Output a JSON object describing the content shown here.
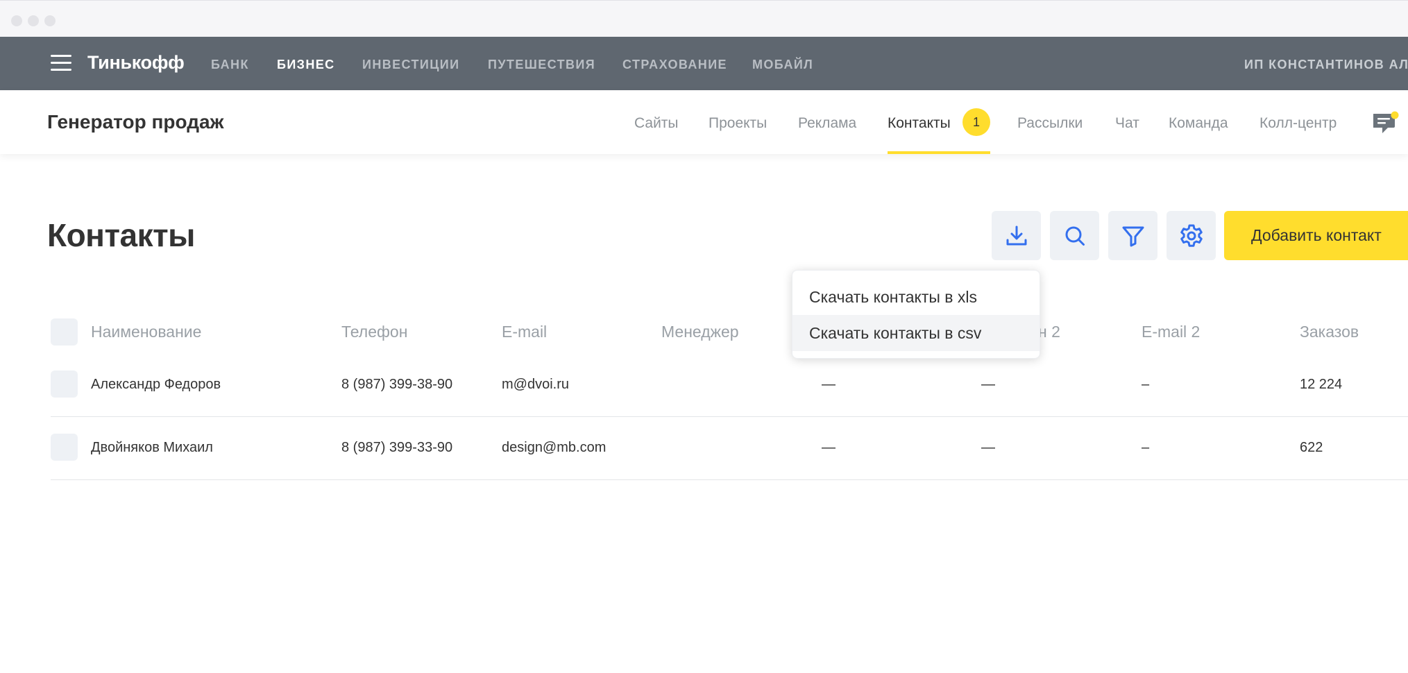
{
  "topnav": {
    "logo": "Тинькофф",
    "items": [
      "БАНК",
      "БИЗНЕС",
      "ИНВЕСТИЦИИ",
      "ПУТЕШЕСТВИЯ",
      "СТРАХОВАНИЕ",
      "МОБАЙЛ"
    ],
    "active": "БИЗНЕС",
    "user": "ИП КОНСТАНТИНОВ АЛ."
  },
  "subheader": {
    "title": "Генератор продаж",
    "tabs": [
      "Сайты",
      "Проекты",
      "Реклама",
      "Контакты",
      "Рассылки",
      "Чат",
      "Команда",
      "Колл-центр"
    ],
    "active_tab": "Контакты",
    "contacts_badge": "1"
  },
  "page": {
    "title": "Контакты",
    "add_button": "Добавить контакт"
  },
  "download_menu": {
    "options": [
      "Скачать контакты в xls",
      "Скачать контакты в csv"
    ]
  },
  "table": {
    "columns": [
      "Наименование",
      "Телефон",
      "E-mail",
      "Менеджер",
      "н 2",
      "E-mail 2",
      "Заказов"
    ],
    "rows": [
      [
        "Александр Федоров",
        "8 (987) 399-38-90",
        "m@dvoi.ru",
        "",
        "—",
        "—",
        "–",
        "12 224"
      ],
      [
        "Двойняков Михаил",
        "8 (987) 399-33-90",
        "design@mb.com",
        "",
        "—",
        "—",
        "–",
        "622"
      ]
    ]
  },
  "colors": {
    "nav_bg": "#5f6770",
    "accent_yellow": "#ffdd2d",
    "icon_blue": "#336fee",
    "button_bg": "#eef1f5"
  }
}
